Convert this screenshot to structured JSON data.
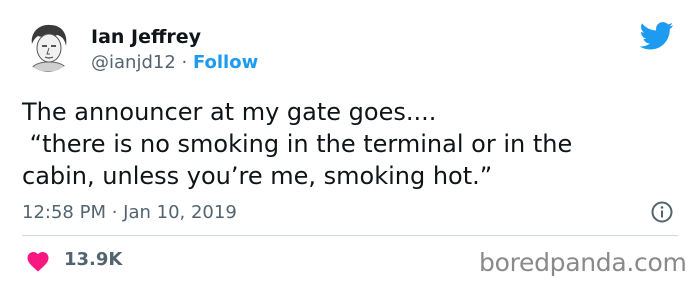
{
  "tweet": {
    "display_name": "Ian Jeffrey",
    "handle": "@ianjd12",
    "separator": " · ",
    "follow_label": "Follow",
    "text": "The announcer at my gate goes....\n “there is no smoking in the terminal or in the\ncabin, unless you’re me, smoking hot.”",
    "timestamp": "12:58 PM · Jan 10, 2019",
    "like_count": "13.9K"
  },
  "icons": {
    "avatar": "avatar",
    "platform": "twitter-bird-icon",
    "info": "info-icon",
    "like": "heart-icon"
  },
  "watermark": {
    "text": "boredpanda.com"
  },
  "colors": {
    "accent": "#1d9bf0",
    "like": "#f91880",
    "text": "#0f1419",
    "secondary": "#536471"
  }
}
